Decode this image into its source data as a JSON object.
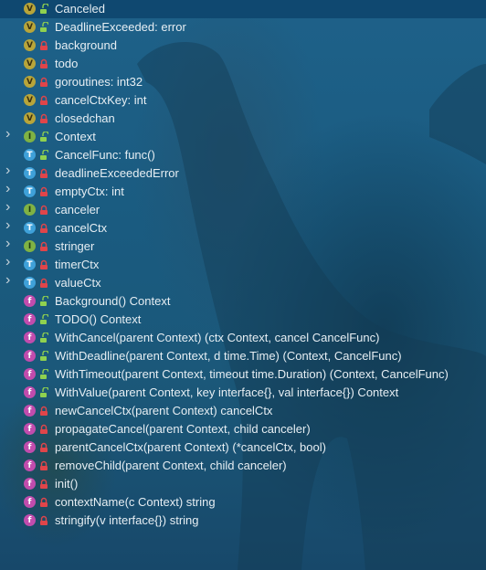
{
  "items": [
    {
      "label": "Canceled",
      "kind": "V",
      "access": "public",
      "selected": true,
      "expandable": false
    },
    {
      "label": "DeadlineExceeded: error",
      "kind": "V",
      "access": "public",
      "expandable": false
    },
    {
      "label": "background",
      "kind": "V",
      "access": "private",
      "expandable": false
    },
    {
      "label": "todo",
      "kind": "V",
      "access": "private",
      "expandable": false
    },
    {
      "label": "goroutines: int32",
      "kind": "V",
      "access": "private",
      "expandable": false
    },
    {
      "label": "cancelCtxKey: int",
      "kind": "V",
      "access": "private",
      "expandable": false
    },
    {
      "label": "closedchan",
      "kind": "V",
      "access": "private",
      "expandable": false
    },
    {
      "label": "Context",
      "kind": "I",
      "access": "public",
      "expandable": true
    },
    {
      "label": "CancelFunc: func()",
      "kind": "T",
      "access": "public",
      "expandable": false
    },
    {
      "label": "deadlineExceededError",
      "kind": "T",
      "access": "private",
      "expandable": true
    },
    {
      "label": "emptyCtx: int",
      "kind": "T",
      "access": "private",
      "expandable": true
    },
    {
      "label": "canceler",
      "kind": "I",
      "access": "private",
      "expandable": true
    },
    {
      "label": "cancelCtx",
      "kind": "T",
      "access": "private",
      "expandable": true
    },
    {
      "label": "stringer",
      "kind": "I",
      "access": "private",
      "expandable": true
    },
    {
      "label": "timerCtx",
      "kind": "T",
      "access": "private",
      "expandable": true
    },
    {
      "label": "valueCtx",
      "kind": "T",
      "access": "private",
      "expandable": true
    },
    {
      "label": "Background() Context",
      "kind": "f",
      "access": "public",
      "expandable": false
    },
    {
      "label": "TODO() Context",
      "kind": "f",
      "access": "public",
      "expandable": false
    },
    {
      "label": "WithCancel(parent Context) (ctx Context, cancel CancelFunc)",
      "kind": "f",
      "access": "public",
      "expandable": false
    },
    {
      "label": "WithDeadline(parent Context, d time.Time) (Context, CancelFunc)",
      "kind": "f",
      "access": "public",
      "expandable": false
    },
    {
      "label": "WithTimeout(parent Context, timeout time.Duration) (Context, CancelFunc)",
      "kind": "f",
      "access": "public",
      "expandable": false
    },
    {
      "label": "WithValue(parent Context, key interface{}, val interface{}) Context",
      "kind": "f",
      "access": "public",
      "expandable": false
    },
    {
      "label": "newCancelCtx(parent Context) cancelCtx",
      "kind": "f",
      "access": "private",
      "expandable": false
    },
    {
      "label": "propagateCancel(parent Context, child canceler)",
      "kind": "f",
      "access": "private",
      "expandable": false
    },
    {
      "label": "parentCancelCtx(parent Context) (*cancelCtx, bool)",
      "kind": "f",
      "access": "private",
      "expandable": false
    },
    {
      "label": "removeChild(parent Context, child canceler)",
      "kind": "f",
      "access": "private",
      "expandable": false
    },
    {
      "label": "init()",
      "kind": "f",
      "access": "private",
      "expandable": false
    },
    {
      "label": "contextName(c Context) string",
      "kind": "f",
      "access": "private",
      "expandable": false
    },
    {
      "label": "stringify(v interface{}) string",
      "kind": "f",
      "access": "private",
      "expandable": false
    }
  ],
  "icons": {
    "V": "variable-icon",
    "T": "type-icon",
    "I": "interface-icon",
    "f": "function-icon"
  },
  "colors": {
    "selected": "#0f4870",
    "variable": "#b8a53a",
    "type": "#3fa1d9",
    "interface": "#7fb244",
    "function": "#c14cad",
    "public_lock": "#8fd14f",
    "private_lock": "#e0454a"
  }
}
